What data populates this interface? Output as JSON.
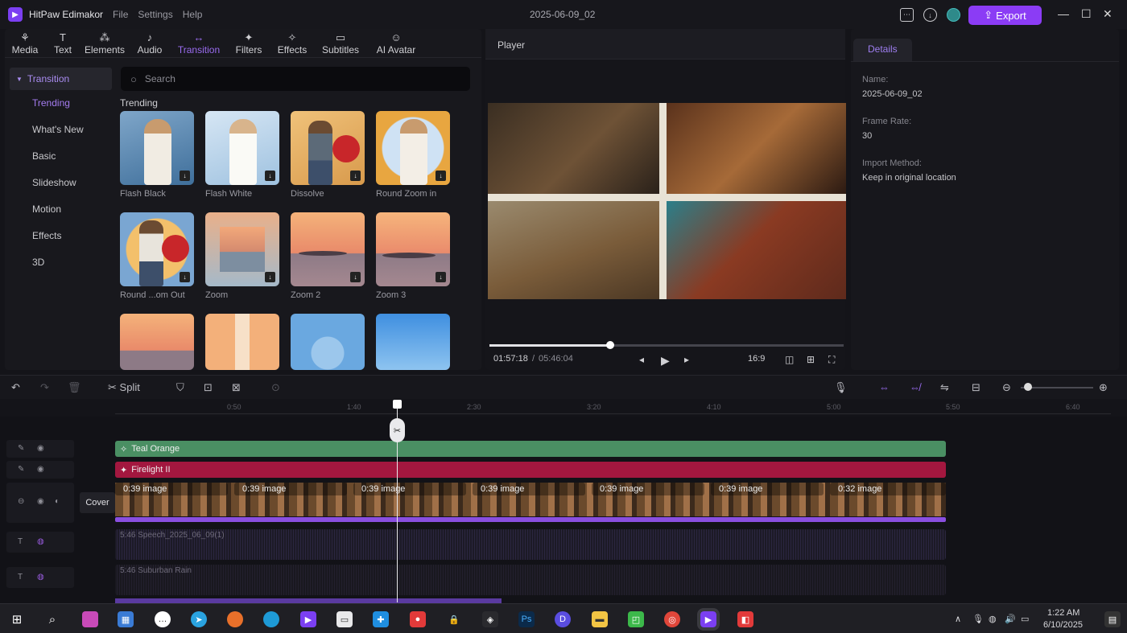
{
  "titlebar": {
    "app_name": "HitPaw Edimakor",
    "menus": [
      "File",
      "Settings",
      "Help"
    ],
    "project_name": "2025-06-09_02",
    "export_label": "Export"
  },
  "toolbar": {
    "tabs": [
      {
        "label": "Media",
        "icon": "media-icon"
      },
      {
        "label": "Text",
        "icon": "text-icon"
      },
      {
        "label": "Elements",
        "icon": "elements-icon"
      },
      {
        "label": "Audio",
        "icon": "audio-icon"
      },
      {
        "label": "Transition",
        "icon": "transition-icon",
        "active": true
      },
      {
        "label": "Filters",
        "icon": "filters-icon"
      },
      {
        "label": "Effects",
        "icon": "effects-icon"
      },
      {
        "label": "Subtitles",
        "icon": "subtitles-icon"
      },
      {
        "label": "AI Avatar",
        "icon": "ai-avatar-icon"
      }
    ]
  },
  "categories": {
    "header": "Transition",
    "items": [
      "Trending",
      "What's New",
      "Basic",
      "Slideshow",
      "Motion",
      "Effects",
      "3D"
    ],
    "selected": "Trending"
  },
  "search": {
    "placeholder": "Search"
  },
  "library": {
    "section_title": "Trending",
    "items": [
      {
        "label": "Flash Black"
      },
      {
        "label": "Flash White"
      },
      {
        "label": "Dissolve"
      },
      {
        "label": "Round Zoom in"
      },
      {
        "label": "Round ...om Out"
      },
      {
        "label": "Zoom"
      },
      {
        "label": "Zoom 2"
      },
      {
        "label": "Zoom 3"
      },
      {
        "label": ""
      },
      {
        "label": ""
      },
      {
        "label": ""
      },
      {
        "label": ""
      }
    ]
  },
  "player": {
    "title": "Player",
    "current_time": "01:57:18",
    "total_time": "05:46:04",
    "aspect_ratio": "16:9",
    "progress": 0.34
  },
  "details": {
    "tab": "Details",
    "name_label": "Name:",
    "name_value": "2025-06-09_02",
    "frame_rate_label": "Frame Rate:",
    "frame_rate_value": "30",
    "import_label": "Import Method:",
    "import_value": "Keep in original location"
  },
  "timeline": {
    "split_label": "Split",
    "ruler": [
      "0:50",
      "1:40",
      "2:30",
      "3:20",
      "4:10",
      "5:00",
      "5:50",
      "6:40"
    ],
    "tracks": {
      "filter_clip": "Teal Orange",
      "effect_clip": "Firelight II",
      "video_clip_label": "0:39 image",
      "video_clip_last": "0:32 image",
      "cover_label": "Cover",
      "audio1": "5:46 Speech_2025_06_09(1)",
      "audio2": "5:46 Suburban Rain"
    }
  },
  "taskbar": {
    "time": "1:22 AM",
    "date": "6/10/2025"
  },
  "colors": {
    "accent": "#8b3cf5",
    "filter_track": "#4a8f63",
    "effect_track": "#a3173f",
    "video_bar": "#8a4fe0"
  }
}
